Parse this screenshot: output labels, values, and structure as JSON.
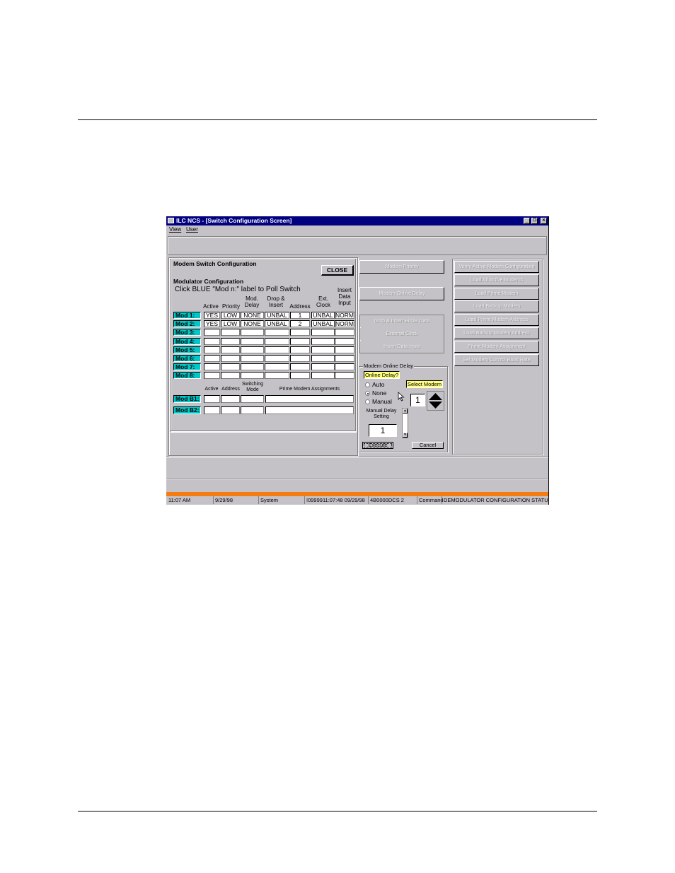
{
  "window": {
    "title": "ILC NCS - [Switch Configuration Screen]",
    "controls": {
      "minimize": "_",
      "restore": "❐",
      "close": "✕"
    }
  },
  "menu": [
    "View",
    "User"
  ],
  "modem_switch": {
    "title": "Modem Switch Configuration",
    "close_label": "CLOSE",
    "modulator_title": "Modulator Configuration",
    "hint": "Click BLUE \"Mod n:\" label to Poll Switch",
    "columns": [
      "Active",
      "Priority",
      "Mod. Delay",
      "Drop & Insert",
      "Address",
      "Ext. Clock",
      "Insert Data Input"
    ],
    "rows": [
      {
        "label": "Mod 1:",
        "values": [
          "YES",
          "LOW",
          "NONE",
          "UNBAL",
          "1",
          "UNBAL",
          "NORM"
        ]
      },
      {
        "label": "Mod 2:",
        "values": [
          "YES",
          "LOW",
          "NONE",
          "UNBAL",
          "2",
          "UNBAL",
          "NORM"
        ]
      },
      {
        "label": "Mod 3:",
        "values": [
          "",
          "",
          "",
          "",
          "",
          "",
          ""
        ]
      },
      {
        "label": "Mod 4:",
        "values": [
          "",
          "",
          "",
          "",
          "",
          "",
          ""
        ]
      },
      {
        "label": "Mod 5:",
        "values": [
          "",
          "",
          "",
          "",
          "",
          "",
          ""
        ]
      },
      {
        "label": "Mod 6:",
        "values": [
          "",
          "",
          "",
          "",
          "",
          "",
          ""
        ]
      },
      {
        "label": "Mod 7:",
        "values": [
          "",
          "",
          "",
          "",
          "",
          "",
          ""
        ]
      },
      {
        "label": "Mod 8:",
        "values": [
          "",
          "",
          "",
          "",
          "",
          "",
          ""
        ]
      }
    ],
    "backup_columns": [
      "Active",
      "Address",
      "Switching Mode",
      "Prime Modem Assignments"
    ],
    "backup_rows": [
      {
        "label": "Mod B1:",
        "values": [
          "",
          "",
          "",
          ""
        ]
      },
      {
        "label": "Mod B2:",
        "values": [
          "",
          "",
          "",
          ""
        ]
      }
    ]
  },
  "middle_buttons": {
    "modem_priority": "Modem Priority",
    "modem_online_delay": "Modem Online Delay",
    "drop_insert": "Drop & Insert Bi/OB Data",
    "external_clock": "External Clock",
    "insert_data_input": "Insert Data Input"
  },
  "online_delay": {
    "group_title": "Modem Online Delay",
    "question": "Online Delay?",
    "options": [
      "Auto",
      "None",
      "Manual"
    ],
    "selected": "None",
    "select_modem_label": "Select Modem",
    "select_modem_value": "1",
    "manual_delay_label": "Manual Delay Setting",
    "manual_delay_value": "1",
    "execute_label": "Execute",
    "cancel_label": "Cancel"
  },
  "right_buttons": [
    "Verify Active Modem Configuration",
    "Load All Active Modems",
    "Load Prime Modem",
    "Load Backup Modem",
    "Load Prime Modem Address",
    "Load Backup Modem Address",
    "Prime Modem Assignment",
    "Set Modem Control Baud Rate"
  ],
  "status_bar": {
    "time": "11:07 AM",
    "date": "9/29/98",
    "user": "System",
    "message_id": "!0999911:07:48 09/29/98",
    "device": "4B0000DCS 2",
    "command": "Command",
    "status": "DEMODULATOR CONFIGURATION STATUS"
  },
  "colors": {
    "title_bar": "#000080",
    "mod_label": "#00c8c8",
    "status_strip": "#f47c10",
    "highlight_label": "#ffff80",
    "window_face": "#c4c2c6"
  }
}
